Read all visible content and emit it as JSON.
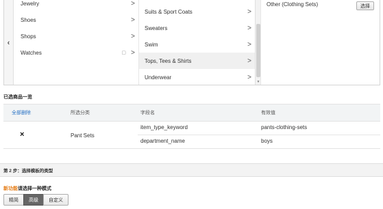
{
  "browser": {
    "back_glyph": "‹",
    "column1": [
      {
        "label": "Jewelry",
        "has_children": true,
        "locked": false
      },
      {
        "label": "Shoes",
        "has_children": true,
        "locked": false
      },
      {
        "label": "Shops",
        "has_children": true,
        "locked": false
      },
      {
        "label": "Watches",
        "has_children": true,
        "locked": true
      }
    ],
    "column2": [
      {
        "label": "Suits & Sport Coats",
        "has_children": true,
        "selected": false
      },
      {
        "label": "Sweaters",
        "has_children": true,
        "selected": false
      },
      {
        "label": "Swim",
        "has_children": true,
        "selected": false
      },
      {
        "label": "Tops, Tees & Shirts",
        "has_children": true,
        "selected": true
      },
      {
        "label": "Underwear",
        "has_children": true,
        "selected": false
      }
    ],
    "column3": {
      "leaf_label": "Other (Clothing Sets)",
      "select_label": "选择"
    }
  },
  "selected_list": {
    "title": "已选商品一览",
    "headers": {
      "remove_all": "全部删除",
      "category": "所选分类",
      "field": "字段名",
      "value": "有效值"
    },
    "rows": [
      {
        "remove_glyph": "×",
        "category": "Pant Sets",
        "fields": [
          {
            "name": "item_type_keyword",
            "value": "pants-clothing-sets"
          },
          {
            "name": "department_name",
            "value": "boys"
          }
        ]
      }
    ]
  },
  "step2": {
    "title": "第 2 步：选择模板的类型",
    "new_feature_tag": "新功能",
    "new_feature_text": "请选择一种模式",
    "modes": [
      {
        "label": "精简",
        "active": false
      },
      {
        "label": "高级",
        "active": true
      },
      {
        "label": "自定义",
        "active": false
      }
    ]
  },
  "colors": {
    "link_blue": "#2a73c5",
    "new_feature_orange": "#e47911",
    "active_mode_bg": "#666666"
  }
}
